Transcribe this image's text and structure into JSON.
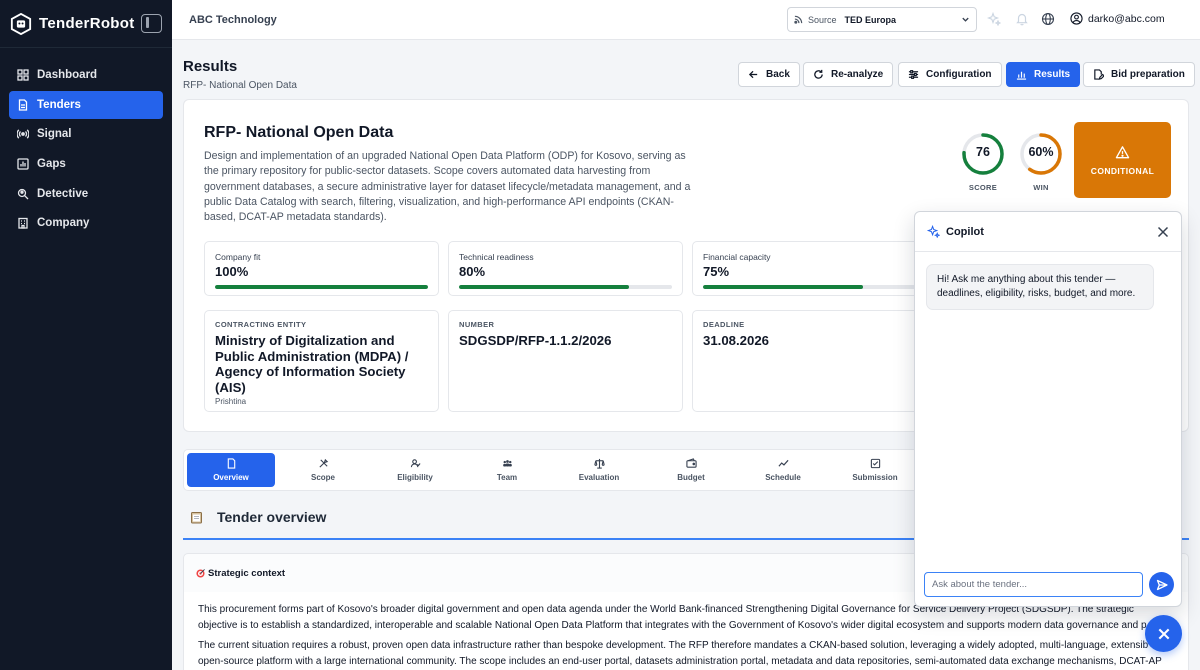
{
  "brand": {
    "name": "TenderRobot"
  },
  "sidebar": {
    "items": [
      {
        "label": "Dashboard",
        "icon": "grid-icon"
      },
      {
        "label": "Tenders",
        "icon": "document-icon",
        "active": true
      },
      {
        "label": "Signal",
        "icon": "signal-icon"
      },
      {
        "label": "Gaps",
        "icon": "chart-icon"
      },
      {
        "label": "Detective",
        "icon": "search-people-icon"
      },
      {
        "label": "Company",
        "icon": "building-icon"
      }
    ]
  },
  "topbar": {
    "org": "ABC Technology",
    "source_label": "Source",
    "source_value": "TED Europa",
    "user_email": "darko@abc.com"
  },
  "header": {
    "title": "Results",
    "subtitle": "RFP- National Open Data",
    "buttons": {
      "back": "Back",
      "reanalyze": "Re-analyze",
      "configuration": "Configuration",
      "results": "Results",
      "bid_preparation": "Bid preparation"
    }
  },
  "summary": {
    "title": "RFP- National Open Data",
    "description": "Design and implementation of an upgraded National Open Data Platform (ODP) for Kosovo, serving as the primary repository for public-sector datasets. Scope covers automated data harvesting from government databases, a secure administrative layer for dataset lifecycle/metadata management, and a public Data Catalog with search, filtering, visualization, and high-performance API endpoints (CKAN-based, DCAT-AP metadata standards).",
    "score": {
      "value": "76",
      "label": "SCORE",
      "fraction": 0.76,
      "color": "#15803d"
    },
    "win": {
      "value": "60%",
      "label": "WIN",
      "fraction": 0.6,
      "color": "#d97706"
    },
    "verdict": "CONDITIONAL",
    "verdict_color": "#d97706",
    "metrics": [
      {
        "label": "Company fit",
        "value": "100%",
        "fraction": 1.0
      },
      {
        "label": "Technical readiness",
        "value": "80%",
        "fraction": 0.8
      },
      {
        "label": "Financial capacity",
        "value": "75%",
        "fraction": 0.75
      }
    ],
    "contracting_entity": {
      "label": "CONTRACTING ENTITY",
      "value": "Ministry of Digitalization and Public Administration (MDPA) / Agency of Information Society (AIS)",
      "location": "Prishtina"
    },
    "number": {
      "label": "NUMBER",
      "value": "SDGSDP/RFP-1.1.2/2026"
    },
    "deadline": {
      "label": "DEADLINE",
      "value": "31.08.2026"
    }
  },
  "tabs": [
    {
      "label": "Overview",
      "icon": "document-icon",
      "active": true
    },
    {
      "label": "Scope",
      "icon": "tools-icon"
    },
    {
      "label": "Eligibility",
      "icon": "user-check-icon"
    },
    {
      "label": "Team",
      "icon": "team-icon"
    },
    {
      "label": "Evaluation",
      "icon": "scale-icon"
    },
    {
      "label": "Budget",
      "icon": "wallet-icon"
    },
    {
      "label": "Schedule",
      "icon": "trend-icon"
    },
    {
      "label": "Submission",
      "icon": "submission-icon"
    }
  ],
  "overview": {
    "title": "Tender overview",
    "context_title": "Strategic context",
    "paragraphs": [
      "This procurement forms part of Kosovo's broader digital government and open data agenda under the World Bank-financed Strengthening Digital Governance for Service Delivery Project (SDGSDP). The strategic objective is to establish a standardized, interoperable and scalable National Open Data Platform that integrates with the Government of Kosovo's wider digital ecosystem and supports modern data governance and p",
      "The current situation requires a robust, proven open data infrastructure rather than bespoke development. The RFP therefore mandates a CKAN-based solution, leveraging a widely adopted, multi-language, extensib open-source platform with a large international community. The scope includes an end-user portal, datasets administration portal, metadata and data repositories, semi-automated data exchange mechanisms, DCAT-AP"
    ]
  },
  "copilot": {
    "title": "Copilot",
    "greeting": "Hi! Ask me anything about this tender — deadlines, eligibility, risks, budget, and more.",
    "input_placeholder": "Ask about the tender..."
  },
  "colors": {
    "accent": "#2563eb",
    "sidebar": "#111827",
    "progress": "#15803d"
  }
}
